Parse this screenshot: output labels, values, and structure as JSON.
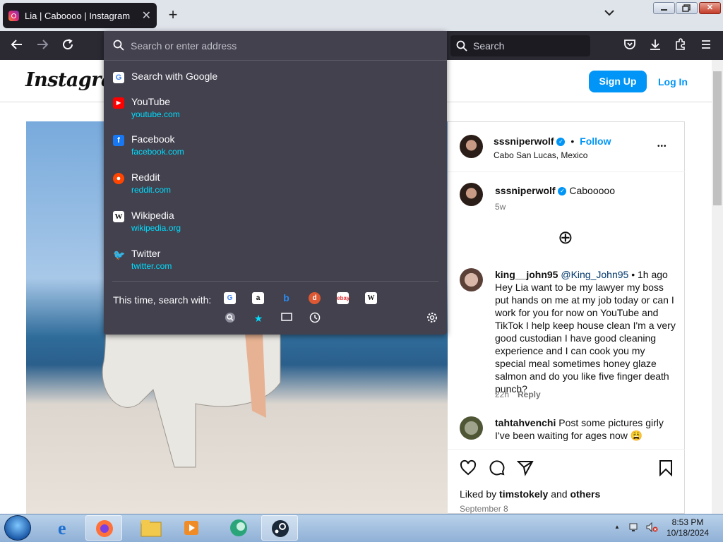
{
  "browser": {
    "tab_title": "Lia | Caboooo | Instagram",
    "tab_close": "✕",
    "new_tab": "+",
    "tabs_menu": "⌄",
    "search_placeholder": "Search",
    "window_close": "✕"
  },
  "urlbar": {
    "placeholder": "Search or enter address",
    "search_with": "Search with Google",
    "suggestions": [
      {
        "title": "YouTube",
        "url": "youtube.com",
        "icon": "youtube-icon",
        "color": "#ff0000"
      },
      {
        "title": "Facebook",
        "url": "facebook.com",
        "icon": "facebook-icon",
        "color": "#1877f2"
      },
      {
        "title": "Reddit",
        "url": "reddit.com",
        "icon": "reddit-icon",
        "color": "#ff4500"
      },
      {
        "title": "Wikipedia",
        "url": "wikipedia.org",
        "icon": "wikipedia-icon",
        "color": "#ffffff"
      },
      {
        "title": "Twitter",
        "url": "twitter.com",
        "icon": "twitter-icon",
        "color": "#1d9bf0"
      }
    ],
    "this_time_label": "This time, search with:",
    "engines": [
      "google-icon",
      "amazon-icon",
      "bing-icon",
      "duckduckgo-icon",
      "ebay-icon",
      "wikipedia-icon"
    ],
    "modes": [
      "search-icon",
      "bookmarks-star-icon",
      "tabs-icon",
      "history-clock-icon"
    ]
  },
  "instagram": {
    "logo": "Instagram",
    "signup": "Sign Up",
    "login": "Log In",
    "post": {
      "author": "sssniperwolf",
      "follow": "Follow",
      "separator": "•",
      "location": "Cabo San Lucas, Mexico",
      "more": "•••",
      "caption": "Cabooooo",
      "caption_age": "5w",
      "add_icon": "⊕",
      "comments": [
        {
          "user": "king__john95",
          "handle": "@King_John95",
          "time": "• 1h ago",
          "text": "Hey Lia want to be my lawyer my boss put hands on me at my job today or can I work for you for now on YouTube and TikTok I help keep house clean I'm a very good custodian I have good cleaning experience and I can cook you my special meal sometimes honey glaze salmon and do you like five finger death punch?",
          "age": "22h",
          "reply": "Reply"
        },
        {
          "user": "tahtahvenchi",
          "text": "Post some pictures girly I've been waiting for ages now 😩"
        }
      ],
      "liked_by_prefix": "Liked by",
      "liked_by_user": "timstokely",
      "liked_by_and": "and",
      "liked_by_others": "others",
      "date": "September 8"
    }
  },
  "taskbar": {
    "time": "8:53 PM",
    "date": "10/18/2024",
    "tray_arrow": "▲"
  }
}
